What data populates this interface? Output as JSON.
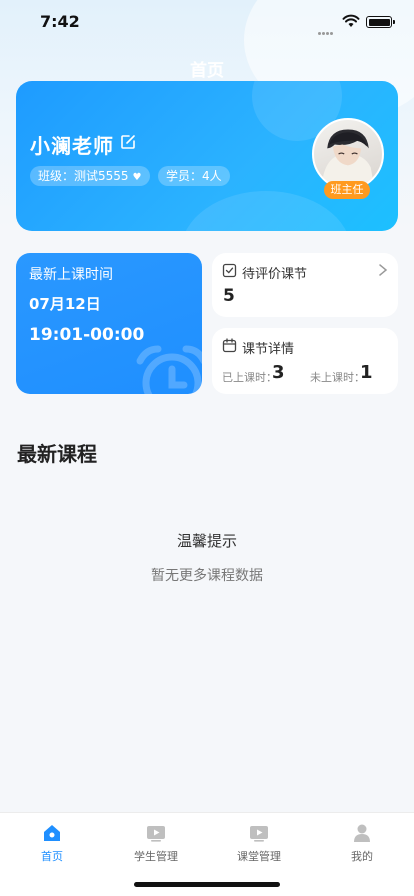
{
  "status_bar": {
    "time": "7:42"
  },
  "nav": {
    "title": "首页"
  },
  "profile": {
    "name": "小澜老师",
    "class_label": "班级：测试5555",
    "student_label": "学员：4人",
    "role_badge": "班主任"
  },
  "latest_class": {
    "title": "最新上课时间",
    "date": "07月12日",
    "time_range": "19:01-00:00"
  },
  "pending_review": {
    "title": "待评价课节",
    "count": "5"
  },
  "class_detail": {
    "title": "课节详情",
    "done_label": "已上课时：",
    "done_value": "3",
    "todo_label": "未上课时：",
    "todo_value": "1"
  },
  "section": {
    "title": "最新课程"
  },
  "empty_state": {
    "title": "温馨提示",
    "message": "暂无更多课程数据"
  },
  "tabs": [
    {
      "label": "首页",
      "icon": "home-icon",
      "active": true
    },
    {
      "label": "学生管理",
      "icon": "video-icon",
      "active": false
    },
    {
      "label": "课堂管理",
      "icon": "video-icon",
      "active": false
    },
    {
      "label": "我的",
      "icon": "person-icon",
      "active": false
    }
  ],
  "colors": {
    "accent": "#1f8fff",
    "badge": "#ff9a1f",
    "background": "#f5f7fa"
  }
}
